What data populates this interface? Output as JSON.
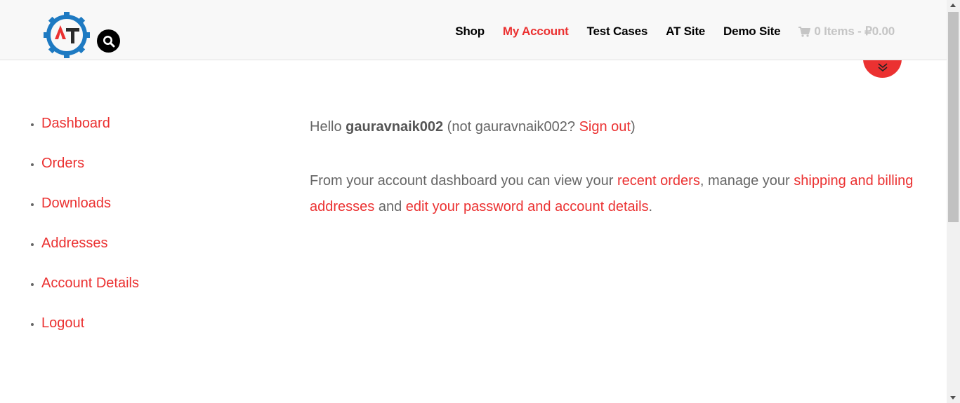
{
  "header": {
    "logo_alt": "AT",
    "nav": [
      {
        "label": "Shop",
        "active": false
      },
      {
        "label": "My Account",
        "active": true
      },
      {
        "label": "Test Cases",
        "active": false
      },
      {
        "label": "AT Site",
        "active": false
      },
      {
        "label": "Demo Site",
        "active": false
      }
    ],
    "cart": {
      "label": "0 Items - ₽0.00"
    }
  },
  "account_nav": [
    "Dashboard",
    "Orders",
    "Downloads",
    "Addresses",
    "Account Details",
    "Logout"
  ],
  "content": {
    "hello": "Hello ",
    "username": "gauravnaik002",
    "not_prefix": " (not gauravnaik002? ",
    "sign_out": "Sign out",
    "not_suffix": ")",
    "dash_text_1": "From your account dashboard you can view your ",
    "recent_orders": "recent orders",
    "dash_text_2": ", manage your ",
    "addresses_link": "shipping and billing addresses",
    "dash_text_3": " and ",
    "account_link": "edit your password and account details",
    "dash_text_4": "."
  },
  "colors": {
    "accent": "#eb3131",
    "header_bg": "#f8f8f8",
    "logo_blue": "#1e7ac2"
  }
}
